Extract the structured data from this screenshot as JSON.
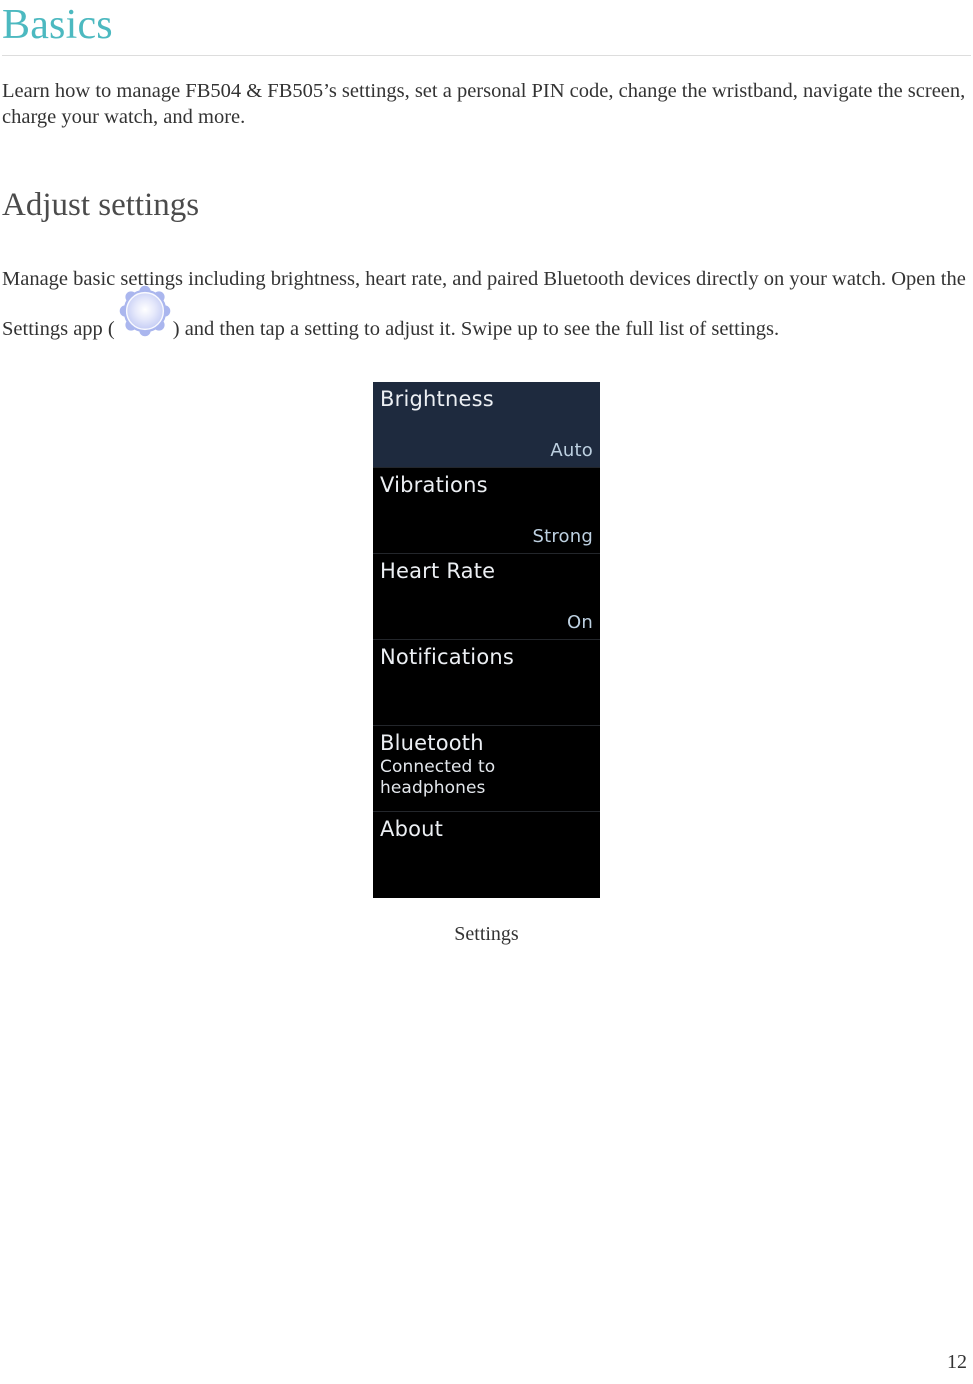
{
  "document": {
    "heading": "Basics",
    "heading_color": "#4cb9c0",
    "intro_paragraph": "Learn how to manage FB504 & FB505’s settings, set a personal PIN code, change the wristband, navigate the screen, charge your watch, and more.",
    "page_number": "12"
  },
  "section": {
    "title": "Adjust settings",
    "paragraph_before_icon": "Manage basic settings including brightness, heart rate, and paired Bluetooth devices directly on your watch. Open the Settings app (",
    "paragraph_after_icon": ") and then tap a setting to adjust it. Swipe up to see the full list of settings.",
    "icon_name": "settings-gear-icon",
    "icon_color": "#aab6ee"
  },
  "figure": {
    "caption": "Settings",
    "screen_background": "#000000",
    "highlight_background": "#1e2a3e",
    "rows": [
      {
        "title": "Brightness",
        "value": "Auto",
        "subtitle": "",
        "highlighted": true
      },
      {
        "title": "Vibrations",
        "value": "Strong",
        "subtitle": "",
        "highlighted": false
      },
      {
        "title": "Heart Rate",
        "value": "On",
        "subtitle": "",
        "highlighted": false
      },
      {
        "title": "Notifications",
        "value": "",
        "subtitle": "",
        "highlighted": false
      },
      {
        "title": "Bluetooth",
        "value": "",
        "subtitle": "Connected to headphones",
        "highlighted": false
      },
      {
        "title": "About",
        "value": "",
        "subtitle": "",
        "highlighted": false
      }
    ]
  }
}
